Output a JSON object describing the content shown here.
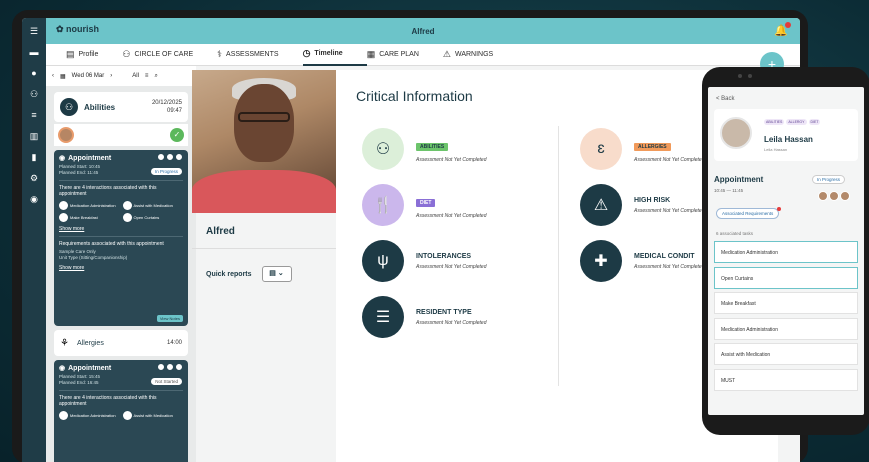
{
  "brand": "nourish",
  "header_name": "Alfred",
  "tabs": [
    {
      "icon": "▤",
      "label": "Profile"
    },
    {
      "icon": "⚇",
      "label": "CIRCLE OF CARE"
    },
    {
      "icon": "⚕",
      "label": "ASSESSMENTS"
    },
    {
      "icon": "◷",
      "label": "Timeline"
    },
    {
      "icon": "▦",
      "label": "CARE PLAN"
    },
    {
      "icon": "⚠",
      "label": "WARNINGS"
    }
  ],
  "fab": "+",
  "datebar": {
    "date": "Wed 06 Mar",
    "filter": "All"
  },
  "abilities_card": {
    "title": "Abilities",
    "date": "20/12/2025",
    "time": "09:47"
  },
  "appointment1": {
    "title": "Appointment",
    "start": "Planned Start: 10:45",
    "end": "Planned End: 11:45",
    "status": "In Progress",
    "desc": "There are 4 interactions associated with this appointment",
    "tasks": [
      "Medication Administration",
      "Assist with Medication",
      "Make Breakfast",
      "Open Curtains"
    ],
    "show_more": "Show more",
    "req": "Requirements associated with this appointment",
    "lines": [
      "Sample Care Only",
      "Unit Type (Sitting/Companionship)"
    ],
    "show_more2": "Show more",
    "view_notes": "View Notes"
  },
  "allergies_card": {
    "title": "Allergies",
    "time": "14:00"
  },
  "appointment2": {
    "title": "Appointment",
    "start": "Planned Start: 15:45",
    "end": "Planned End: 16:45",
    "status": "Not Started",
    "desc": "There are 4 interactions associated with this appointment",
    "tasks": [
      "Medication Administration",
      "Assist with Medication"
    ]
  },
  "patient": {
    "name": "Alfred",
    "quick_reports": "Quick reports"
  },
  "critical": {
    "title": "Critical Information",
    "items": [
      {
        "tag": "ABILITIES",
        "title": "",
        "status": "Assessment Not Yet Completed"
      },
      {
        "tag": "DIET",
        "title": "",
        "status": "Assessment Not Yet Completed"
      },
      {
        "tag": "",
        "title": "INTOLERANCES",
        "status": "Assessment Not Yet Completed"
      },
      {
        "tag": "",
        "title": "RESIDENT TYPE",
        "status": "Assessment Not Yet Completed"
      },
      {
        "tag": "ALLERGIES",
        "title": "",
        "status": "Assessment Not Yet Completed"
      },
      {
        "tag": "",
        "title": "HIGH RISK",
        "status": "Assessment Not Yet Completed"
      },
      {
        "tag": "",
        "title": "MEDICAL CONDIT",
        "status": "Assessment Not Yet Completed"
      }
    ]
  },
  "phone": {
    "back": "< Back",
    "tags": [
      "ABILITIES",
      "ALLERGY",
      "DIET"
    ],
    "name": "Leila Hassan",
    "sub": "Leila Hassan",
    "appt": "Appointment",
    "time": "10:45 — 11:45",
    "status": "In Progress",
    "req_btn": "Associated Requirements",
    "count": "6 associated tasks",
    "tasks": [
      "Medication Administration",
      "Open Curtains",
      "Make Breakfast",
      "Medication Administration",
      "Assist with Medication",
      "MUST"
    ]
  }
}
